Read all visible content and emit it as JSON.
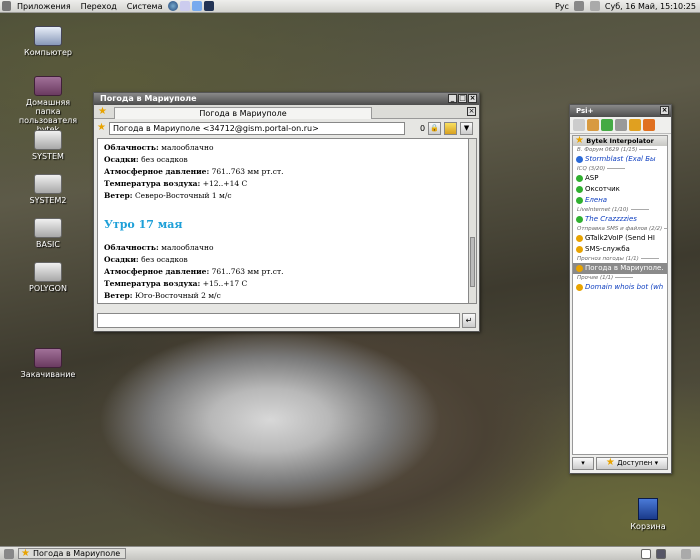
{
  "topbar": {
    "menus": [
      "Приложения",
      "Переход",
      "Система"
    ],
    "layout": "Рус",
    "clock": "Суб, 16 Май, 15:10:25"
  },
  "desktop_icons": [
    {
      "label": "Компьютер",
      "icon": "computer-icon"
    },
    {
      "label": "Домашняя папка пользователя bytek",
      "icon": "home-folder-icon"
    },
    {
      "label": "SYSTEM",
      "icon": "drive-icon"
    },
    {
      "label": "SYSTEM2",
      "icon": "drive-icon"
    },
    {
      "label": "BASIC",
      "icon": "drive-icon"
    },
    {
      "label": "POLYGON",
      "icon": "drive-icon"
    },
    {
      "label": "Закачивание",
      "icon": "folder-icon"
    }
  ],
  "chat": {
    "title": "Погода в Мариуполе",
    "tab": "Погода в Мариуполе",
    "contact": "Погода в Мариуполе <34712@gism.portal-on.ru>",
    "counter": "0",
    "messages": [
      {
        "label": "Облачность:",
        "value": "малооблачно"
      },
      {
        "label": "Осадки:",
        "value": "без осадков"
      },
      {
        "label": "Атмосферное давление:",
        "value": "761..763 мм рт.ст."
      },
      {
        "label": "Температура воздуха:",
        "value": "+12..+14 С"
      },
      {
        "label": "Ветер:",
        "value": "Северо-Восточный 1 м/с"
      }
    ],
    "heading": "Утро 17 мая",
    "messages2": [
      {
        "label": "Облачность:",
        "value": "малооблачно"
      },
      {
        "label": "Осадки:",
        "value": "без осадков"
      },
      {
        "label": "Атмосферное давление:",
        "value": "761..763 мм рт.ст."
      },
      {
        "label": "Температура воздуха:",
        "value": "+15..+17 С"
      },
      {
        "label": "Ветер:",
        "value": "Юго-Восточный 2 м/с"
      }
    ]
  },
  "psi": {
    "title": "Psi+",
    "account": "Bytek Interpolator",
    "status": "Доступен",
    "roster": [
      {
        "type": "group",
        "text": "В. Форум 0629 (1/15)"
      },
      {
        "type": "contact",
        "text": "Stormblast (Exal Бы",
        "color": "#2a6ad8",
        "style": "blue"
      },
      {
        "type": "group",
        "text": "ICQ (3/20)"
      },
      {
        "type": "contact",
        "text": "ASP",
        "color": "#30b030"
      },
      {
        "type": "contact",
        "text": "Оксотчик",
        "color": "#30b030"
      },
      {
        "type": "contact",
        "text": "Елена",
        "color": "#30b030",
        "style": "blue"
      },
      {
        "type": "group",
        "text": "LiveInternet (1/10)"
      },
      {
        "type": "contact",
        "text": "The Crazzzzies",
        "color": "#30b030",
        "style": "blue"
      },
      {
        "type": "group",
        "text": "Отправка SMS и файлов (2/2)"
      },
      {
        "type": "contact",
        "text": "GTalk2VoIP (Send HI",
        "color": "#e8a300"
      },
      {
        "type": "contact",
        "text": "SMS-служба",
        "color": "#e8a300"
      },
      {
        "type": "group",
        "text": "Прогноз погоды (1/1)"
      },
      {
        "type": "contact",
        "text": "Погода в Мариуполе.",
        "color": "#e8a300",
        "style": "sel"
      },
      {
        "type": "group",
        "text": "Прочие (1/1)"
      },
      {
        "type": "contact",
        "text": "Domain whois bot (wh",
        "color": "#e8a300",
        "style": "blue"
      }
    ]
  },
  "taskbar": {
    "item": "Погода в Мариуполе"
  },
  "trash": {
    "label": "Корзина"
  }
}
